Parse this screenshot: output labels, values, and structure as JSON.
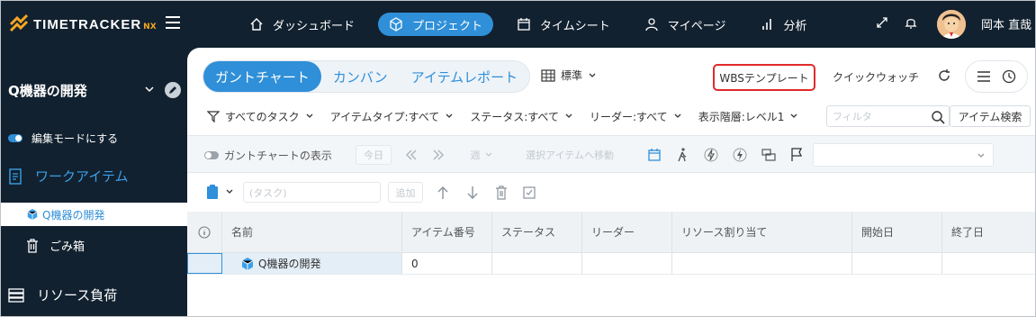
{
  "app": {
    "logo_text": "TIMETRACKER",
    "logo_suffix": "NX",
    "user_name": "岡本 直哉"
  },
  "nav": {
    "items": [
      {
        "label": "ダッシュボード",
        "icon": "home-icon",
        "active": false
      },
      {
        "label": "プロジェクト",
        "icon": "cube-icon",
        "active": true
      },
      {
        "label": "タイムシート",
        "icon": "calendar-icon",
        "active": false
      },
      {
        "label": "マイページ",
        "icon": "person-icon",
        "active": false
      },
      {
        "label": "分析",
        "icon": "bar-chart-icon",
        "active": false
      }
    ]
  },
  "sidebar": {
    "project_title": "Q機器の開発",
    "edit_mode_label": "編集モードにする",
    "work_items_label": "ワークアイテム",
    "project_node_label": "Q機器の開発",
    "trash_label": "ごみ箱",
    "resource_label": "リソース負荷"
  },
  "main": {
    "view_tabs": [
      "ガントチャート",
      "カンバン",
      "アイテムレポート"
    ],
    "layout_select": "標準",
    "wbs_template": "WBSテンプレート",
    "quick_watch": "クイックウォッチ",
    "filters": [
      {
        "label": "すべてのタスク",
        "icon": "filter-icon"
      },
      {
        "label": "アイテムタイプ:すべて"
      },
      {
        "label": "ステータス:すべて"
      },
      {
        "label": "リーダー:すべて"
      },
      {
        "label": "表示階層:レベル1"
      }
    ],
    "filter_placeholder": "フィルタ",
    "item_search": "アイテム検索",
    "gantt_toggle_label": "ガントチャートの表示",
    "today_btn": "今日",
    "week_select": "週",
    "move_to_selected": "選択アイテムへ移動",
    "task_placeholder": "(タスク)",
    "add_btn": "追加"
  },
  "grid": {
    "columns": [
      "名前",
      "アイテム番号",
      "ステータス",
      "リーダー",
      "リソース割り当て",
      "開始日",
      "終了日"
    ],
    "rows": [
      {
        "name": "Q機器の開発",
        "item_no": "0",
        "status": "",
        "leader": "",
        "resource": "",
        "start": "",
        "end": ""
      }
    ]
  },
  "colors": {
    "accent": "#2f8fd8",
    "topbar": "#12212f",
    "highlight_border": "#e02a2a"
  }
}
